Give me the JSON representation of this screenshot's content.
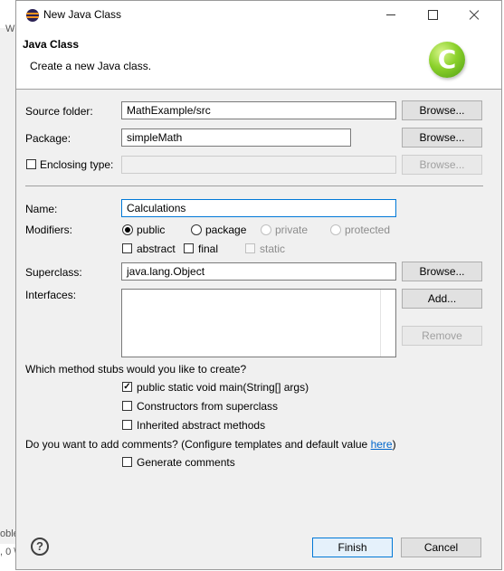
{
  "window": {
    "title": "New Java Class"
  },
  "background": {
    "left_text": [
      "W",
      "oble",
      ", 0 \\"
    ]
  },
  "banner": {
    "title": "Java Class",
    "description": "Create a new Java class.",
    "logo_letter": "C"
  },
  "source_folder": {
    "label": "Source folder:",
    "value": "MathExample/src",
    "browse": "Browse..."
  },
  "package": {
    "label": "Package:",
    "value": "simpleMath",
    "browse": "Browse..."
  },
  "enclosing_type": {
    "label": "Enclosing type:",
    "checked": false,
    "value": "",
    "browse": "Browse..."
  },
  "name": {
    "label": "Name:",
    "value": "Calculations"
  },
  "modifiers": {
    "label": "Modifiers:",
    "access": [
      {
        "label": "public",
        "selected": true,
        "enabled": true
      },
      {
        "label": "package",
        "selected": false,
        "enabled": true
      },
      {
        "label": "private",
        "selected": false,
        "enabled": false
      },
      {
        "label": "protected",
        "selected": false,
        "enabled": false
      }
    ],
    "flags": [
      {
        "label": "abstract",
        "checked": false,
        "enabled": true
      },
      {
        "label": "final",
        "checked": false,
        "enabled": true
      },
      {
        "label": "static",
        "checked": false,
        "enabled": false
      }
    ]
  },
  "superclass": {
    "label": "Superclass:",
    "value": "java.lang.Object",
    "browse": "Browse..."
  },
  "interfaces": {
    "label": "Interfaces:",
    "add": "Add...",
    "remove": "Remove"
  },
  "stubs": {
    "question": "Which method stubs would you like to create?",
    "options": [
      {
        "label": "public static void main(String[] args)",
        "checked": true
      },
      {
        "label": "Constructors from superclass",
        "checked": false
      },
      {
        "label": "Inherited abstract methods",
        "checked": false
      }
    ]
  },
  "comments": {
    "question": "Do you want to add comments? (Configure templates and default value ",
    "link": "here",
    "suffix": ")",
    "option": {
      "label": "Generate comments",
      "checked": false
    }
  },
  "footer": {
    "help": "?",
    "finish": "Finish",
    "cancel": "Cancel"
  }
}
